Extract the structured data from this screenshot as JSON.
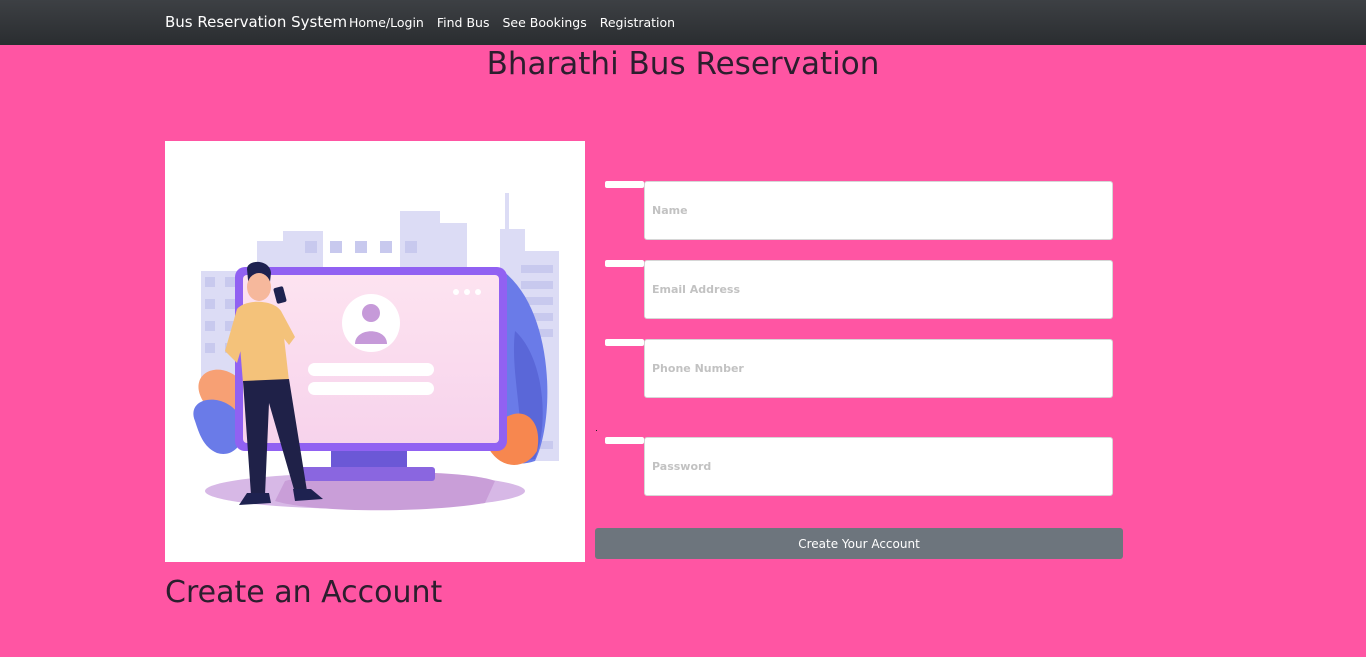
{
  "navbar": {
    "brand": "Bus Reservation System",
    "links": [
      "Home/Login",
      "Find Bus",
      "See Bookings",
      "Registration"
    ]
  },
  "page_title": "Bharathi Bus Reservation",
  "form": {
    "fields": [
      {
        "placeholder": "Name",
        "value": ""
      },
      {
        "placeholder": "Email Address",
        "value": ""
      },
      {
        "placeholder": "Phone Number",
        "value": ""
      },
      {
        "placeholder": "Password",
        "value": ""
      }
    ],
    "submit_label": "Create Your Account"
  },
  "section_title": "Create an Account",
  "colors": {
    "page_background": "#ff55a3",
    "navbar": "#343a40",
    "button": "#6d757d"
  }
}
